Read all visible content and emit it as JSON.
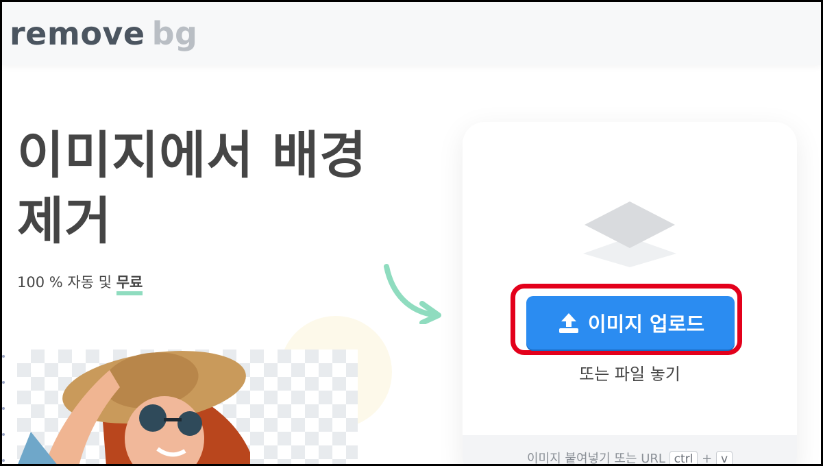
{
  "header": {
    "logo_part1": "remove",
    "logo_part2": "bg"
  },
  "hero": {
    "title_line1": "이미지에서 배경",
    "title_line2": "제거",
    "subtitle_prefix": "100 % 자동 및",
    "subtitle_highlight": "무료"
  },
  "upload": {
    "button_label": "이미지 업로드",
    "drop_text": "또는 파일 놓기",
    "paste_text": "이미지 붙여넣기 또는 URL",
    "key_ctrl": "ctrl",
    "key_plus": "+",
    "key_v": "v"
  },
  "colors": {
    "accent_blue": "#2b8cf1",
    "highlight_red": "#e3001b",
    "underline_green": "#8fdcbf"
  }
}
